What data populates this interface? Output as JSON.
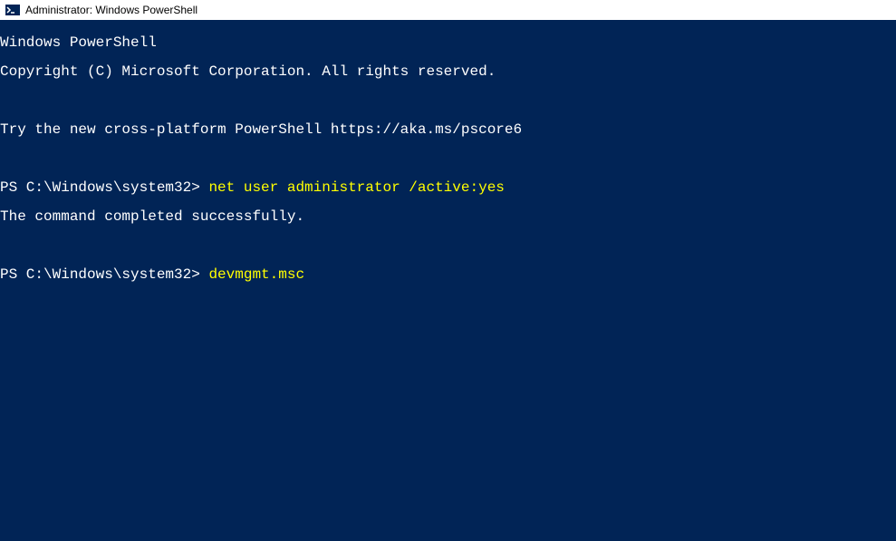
{
  "window": {
    "title": "Administrator: Windows PowerShell"
  },
  "terminal": {
    "lines": {
      "header1": "Windows PowerShell",
      "header2": "Copyright (C) Microsoft Corporation. All rights reserved.",
      "blank1": "",
      "try_line": "Try the new cross-platform PowerShell https://aka.ms/pscore6",
      "blank2": "",
      "prompt1": "PS C:\\Windows\\system32> ",
      "command1": "net user administrator /active:yes",
      "result1": "The command completed successfully.",
      "blank3": "",
      "prompt2": "PS C:\\Windows\\system32> ",
      "command2": "devmgmt.msc"
    }
  },
  "colors": {
    "terminal_bg": "#012456",
    "terminal_fg": "#ffffff",
    "command_fg": "#ffff00"
  }
}
